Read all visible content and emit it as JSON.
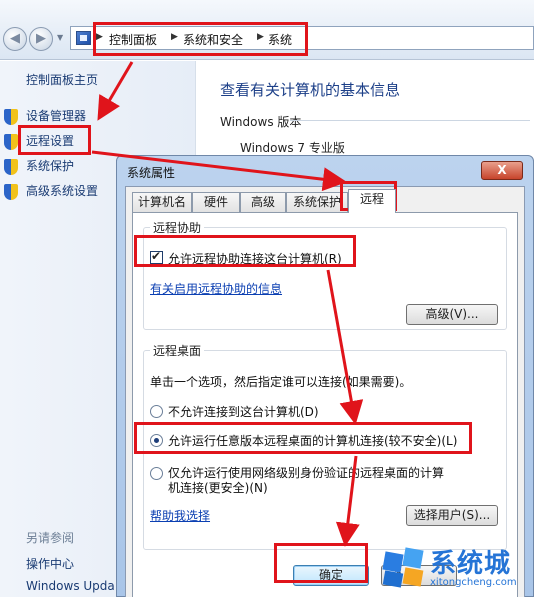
{
  "address_bar": {
    "crumbs": [
      "控制面板",
      "系统和安全",
      "系统"
    ],
    "back_icon": "back-arrow-icon",
    "forward_icon": "forward-arrow-icon"
  },
  "sidebar": {
    "home": "控制面板主页",
    "items": [
      {
        "label": "设备管理器",
        "icon": "shield-icon"
      },
      {
        "label": "远程设置",
        "icon": "shield-icon"
      },
      {
        "label": "系统保护",
        "icon": "shield-icon"
      },
      {
        "label": "高级系统设置",
        "icon": "shield-icon"
      }
    ],
    "see_also": "另请参阅",
    "links": [
      "操作中心",
      "Windows Upda"
    ]
  },
  "main": {
    "title": "查看有关计算机的基本信息",
    "edition_label": "Windows 版本",
    "edition_value": "Windows 7 专业版"
  },
  "dialog": {
    "title": "系统属性",
    "close_label": "X",
    "tabs": [
      "计算机名",
      "硬件",
      "高级",
      "系统保护",
      "远程"
    ],
    "active_tab": "远程",
    "remote_assistance": {
      "group_title": "远程协助",
      "checkbox_label": "允许远程协助连接这台计算机(R)",
      "checked": true,
      "info_link": "有关启用远程协助的信息",
      "advanced_button": "高级(V)..."
    },
    "remote_desktop": {
      "group_title": "远程桌面",
      "instruction": "单击一个选项，然后指定谁可以连接(如果需要)。",
      "options": [
        "不允许连接到这台计算机(D)",
        "允许运行任意版本远程桌面的计算机连接(较不安全)(L)",
        "仅允许运行使用网络级别身份验证的远程桌面的计算机连接(更安全)(N)"
      ],
      "option_3_line1": "仅允许运行使用网络级别身份验证的远程桌面的计算",
      "option_3_line2": "机连接(更安全)(N)",
      "selected_index": 1,
      "help_link": "帮助我选择",
      "select_users_button": "选择用户(S)..."
    },
    "ok_button": "确定",
    "cancel_button_partial": "消"
  },
  "watermark": {
    "name": "系统城",
    "url": "xitongcheng.com"
  },
  "annotation_color": "#e0141b"
}
